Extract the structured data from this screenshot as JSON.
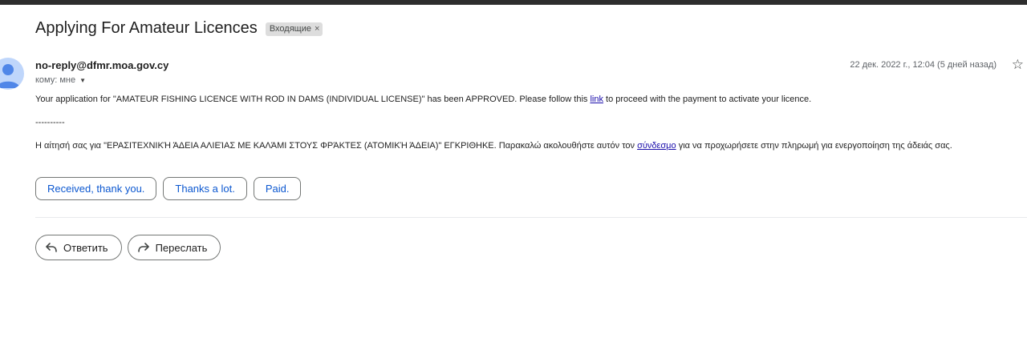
{
  "email": {
    "subject": "Applying For Amateur Licences",
    "label": "Входящие",
    "label_remove": "×",
    "sender": "no-reply@dfmr.moa.gov.cy",
    "to": "кому: мне",
    "date": "22 дек. 2022 г., 12:04 (5 дней назад)",
    "body": {
      "line1_before": "Your application for \"AMATEUR FISHING LICENCE WITH ROD IN DAMS (INDIVIDUAL LICENSE)\" has been APPROVED. Please follow this ",
      "line1_link": "link",
      "line1_after": " to proceed with the payment to activate your licence.",
      "separator": "----------",
      "line3_before": "Η αίτησή σας για \"ΕΡΑΣΙΤΕΧΝΙΚΉ ΆΔΕΙΑ ΑΛΙΕΊΑΣ ΜΕ ΚΑΛΆΜΙ ΣΤΟΥΣ ΦΡΆΚΤΕΣ (ΑΤΟΜΙΚΉ ΆΔΕΙΑ)\" ΕΓΚΡΙΘΗΚΕ. Παρακαλώ ακολουθήστε αυτόν τον ",
      "line3_link": "σύνδεσμο",
      "line3_after": " για να προχωρήσετε στην πληρωμή για ενεργοποίηση της άδειάς σας."
    }
  },
  "smart_replies": [
    "Received, thank you.",
    "Thanks a lot.",
    "Paid."
  ],
  "actions": {
    "reply": "Ответить",
    "forward": "Переслать"
  },
  "icons": {
    "avatar": "person-avatar-icon",
    "star": "star-outline-icon",
    "reply": "reply-arrow-icon",
    "forward": "forward-arrow-icon",
    "caret": "caret-down-icon"
  },
  "colors": {
    "link": "#1a0dab",
    "chip_text": "#0b57d0",
    "avatar_bg": "#bfd6fb",
    "avatar_fg": "#4f86e8"
  }
}
